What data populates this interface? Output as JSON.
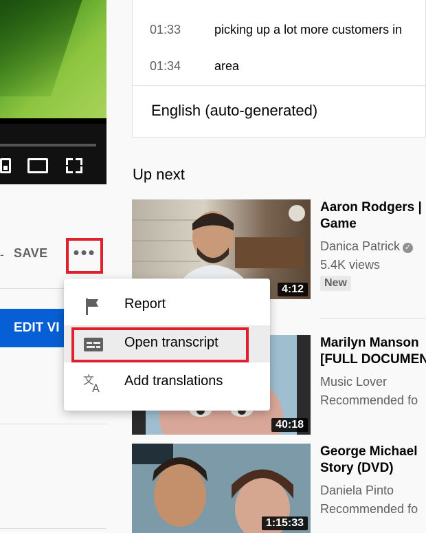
{
  "transcript": {
    "partial_text": "",
    "rows": [
      {
        "time": "01:33",
        "text": "picking up a lot more customers in"
      },
      {
        "time": "01:34",
        "text": "area"
      }
    ],
    "language": "English (auto-generated)"
  },
  "left": {
    "save_label": "SAVE",
    "more_glyph": "•••",
    "edit_label": "EDIT VI"
  },
  "up_next_label": "Up next",
  "videos": [
    {
      "title_1": "Aaron Rodgers |",
      "title_2": "Game",
      "channel": "Danica Patrick",
      "meta": "5.4K views",
      "badge": "New",
      "duration": "4:12"
    },
    {
      "title_1": "Marilyn Manson",
      "title_2": "[FULL DOCUMEN",
      "channel": "Music Lover",
      "meta": "Recommended fo",
      "duration": "40:18"
    },
    {
      "title_1": "George Michael",
      "title_2": "Story (DVD)",
      "channel": "Daniela Pinto",
      "meta": "Recommended fo",
      "duration": "1:15:33"
    }
  ],
  "menu": {
    "items": [
      {
        "label": "Report",
        "icon": "flag-icon"
      },
      {
        "label": "Open transcript",
        "icon": "transcript-icon"
      },
      {
        "label": "Add translations",
        "icon": "translate-icon"
      }
    ]
  },
  "colors": {
    "highlight_red": "#e0202d",
    "blue_button": "#065fd4"
  }
}
